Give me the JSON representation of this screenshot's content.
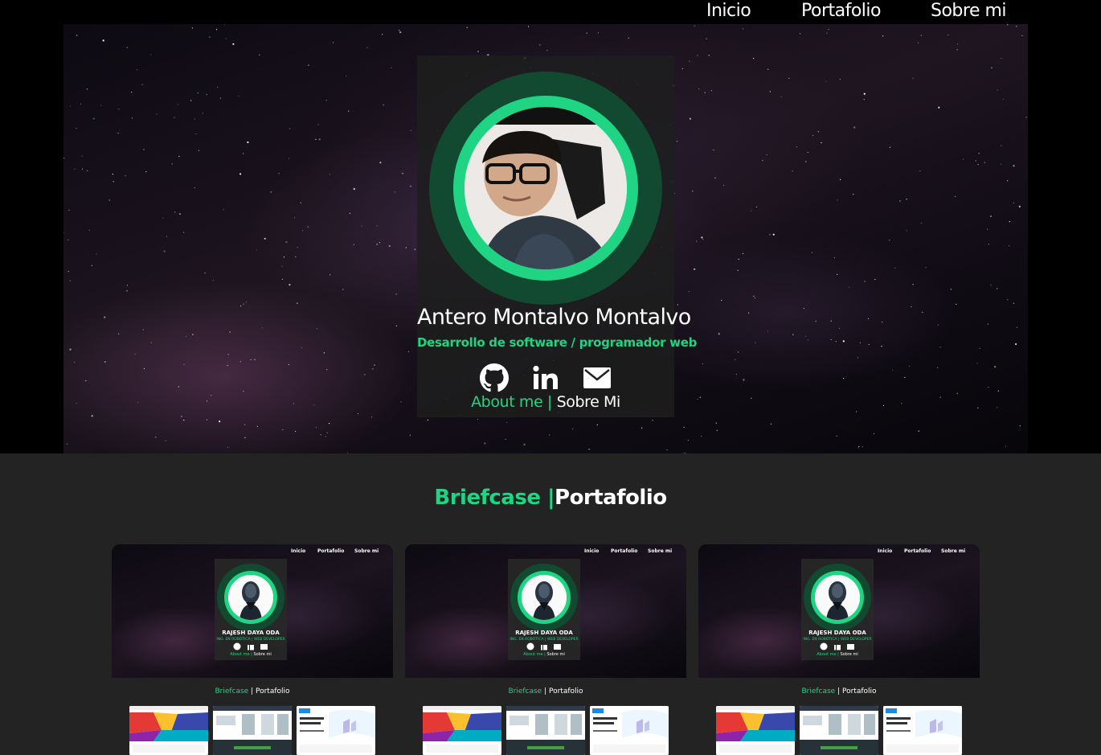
{
  "nav": {
    "inicio": "Inicio",
    "portafolio": "Portafolio",
    "sobre": "Sobre mi"
  },
  "hero": {
    "name": "Antero Montalvo Montalvo",
    "role": "Desarrollo de software / programador web",
    "about_en": "About me | ",
    "about_es": "Sobre Mi",
    "icons": [
      "github-icon",
      "linkedin-icon",
      "mail-icon"
    ]
  },
  "portfolio": {
    "title_en": "Briefcase |",
    "title_es": "Portafolio",
    "projects": [
      {
        "nav": [
          "Inicio",
          "Portafolio",
          "Sobre mi"
        ],
        "name": "RAJESH DAYA ODA",
        "role": "ING. EN ROBÓTICA | WEB DEVELOPER",
        "about_en": "About me | ",
        "about_es": "Sobre mi",
        "title_en": "Briefcase",
        "title_es": " | Portafolio"
      },
      {
        "nav": [
          "Inicio",
          "Portafolio",
          "Sobre mi"
        ],
        "name": "RAJESH DAYA ODA",
        "role": "ING. EN ROBÓTICA | WEB DEVELOPER",
        "about_en": "About me | ",
        "about_es": "Sobre mi",
        "title_en": "Briefcase",
        "title_es": " | Portafolio"
      },
      {
        "nav": [
          "Inicio",
          "Portafolio",
          "Sobre mi"
        ],
        "name": "RAJESH DAYA ODA",
        "role": "ING. EN ROBÓTICA | WEB DEVELOPER",
        "about_en": "About me | ",
        "about_es": "Sobre mi",
        "title_en": "Briefcase",
        "title_es": " | Portafolio"
      }
    ]
  },
  "colors": {
    "accent": "#1fd482",
    "ring_dark": "#114a30",
    "section_bg": "#232323"
  }
}
